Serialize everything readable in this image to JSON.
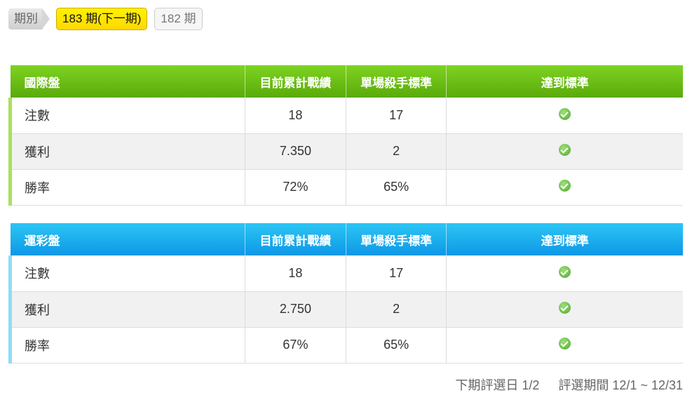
{
  "period": {
    "label": "期別",
    "active": "183 期(下一期)",
    "inactive": "182 期"
  },
  "tables": [
    {
      "headers": [
        "國際盤",
        "目前累計戰績",
        "單場殺手標準",
        "達到標準"
      ],
      "rows": [
        {
          "label": "注數",
          "current": "18",
          "standard": "17",
          "met": true
        },
        {
          "label": "獲利",
          "current": "7.350",
          "standard": "2",
          "met": true
        },
        {
          "label": "勝率",
          "current": "72%",
          "standard": "65%",
          "met": true
        }
      ]
    },
    {
      "headers": [
        "運彩盤",
        "目前累計戰績",
        "單場殺手標準",
        "達到標準"
      ],
      "rows": [
        {
          "label": "注數",
          "current": "18",
          "standard": "17",
          "met": true
        },
        {
          "label": "獲利",
          "current": "2.750",
          "standard": "2",
          "met": true
        },
        {
          "label": "勝率",
          "current": "67%",
          "standard": "65%",
          "met": true
        }
      ]
    }
  ],
  "footer": {
    "next_selection": "下期評選日 1/2",
    "selection_period": "評選期間 12/1 ~ 12/31"
  },
  "colors": {
    "green_header": "#6cc416",
    "blue_header": "#1aaeee",
    "active_period": "#ffe600"
  },
  "icons": {
    "met": "check-circle-icon"
  }
}
